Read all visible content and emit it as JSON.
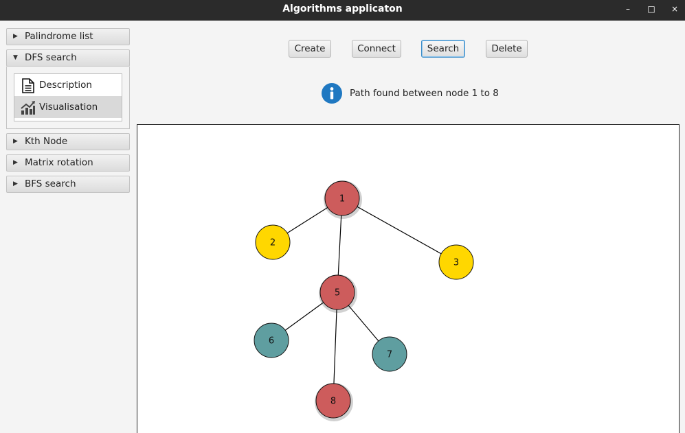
{
  "window": {
    "title": "Algorithms applicaton",
    "controls": {
      "minimize": "–",
      "maximize": "□",
      "close": "×"
    }
  },
  "sidebar": {
    "sections": [
      {
        "label": "Palindrome list",
        "expanded": false
      },
      {
        "label": "DFS search",
        "expanded": true,
        "items": [
          {
            "label": "Description",
            "icon": "document-icon",
            "selected": false
          },
          {
            "label": "Visualisation",
            "icon": "chart-icon",
            "selected": true
          }
        ]
      },
      {
        "label": "Kth Node",
        "expanded": false
      },
      {
        "label": "Matrix rotation",
        "expanded": false
      },
      {
        "label": "BFS search",
        "expanded": false
      }
    ]
  },
  "toolbar": {
    "create_label": "Create",
    "connect_label": "Connect",
    "search_label": "Search",
    "delete_label": "Delete",
    "focused_button": "Search"
  },
  "status": {
    "icon": "info-icon",
    "message": "Path found between node 1 to 8"
  },
  "graph": {
    "colors": {
      "path": "#cd5c5c",
      "leaf_yellow": "#ffd700",
      "leaf_teal": "#5f9ea0",
      "edge": "#000000"
    },
    "nodes": [
      {
        "id": "1",
        "color": "path"
      },
      {
        "id": "2",
        "color": "leaf_yellow"
      },
      {
        "id": "3",
        "color": "leaf_yellow"
      },
      {
        "id": "5",
        "color": "path"
      },
      {
        "id": "6",
        "color": "leaf_teal"
      },
      {
        "id": "7",
        "color": "leaf_teal"
      },
      {
        "id": "8",
        "color": "path"
      }
    ],
    "edges": [
      [
        "1",
        "2"
      ],
      [
        "1",
        "3"
      ],
      [
        "1",
        "5"
      ],
      [
        "5",
        "6"
      ],
      [
        "5",
        "7"
      ],
      [
        "5",
        "8"
      ]
    ]
  }
}
